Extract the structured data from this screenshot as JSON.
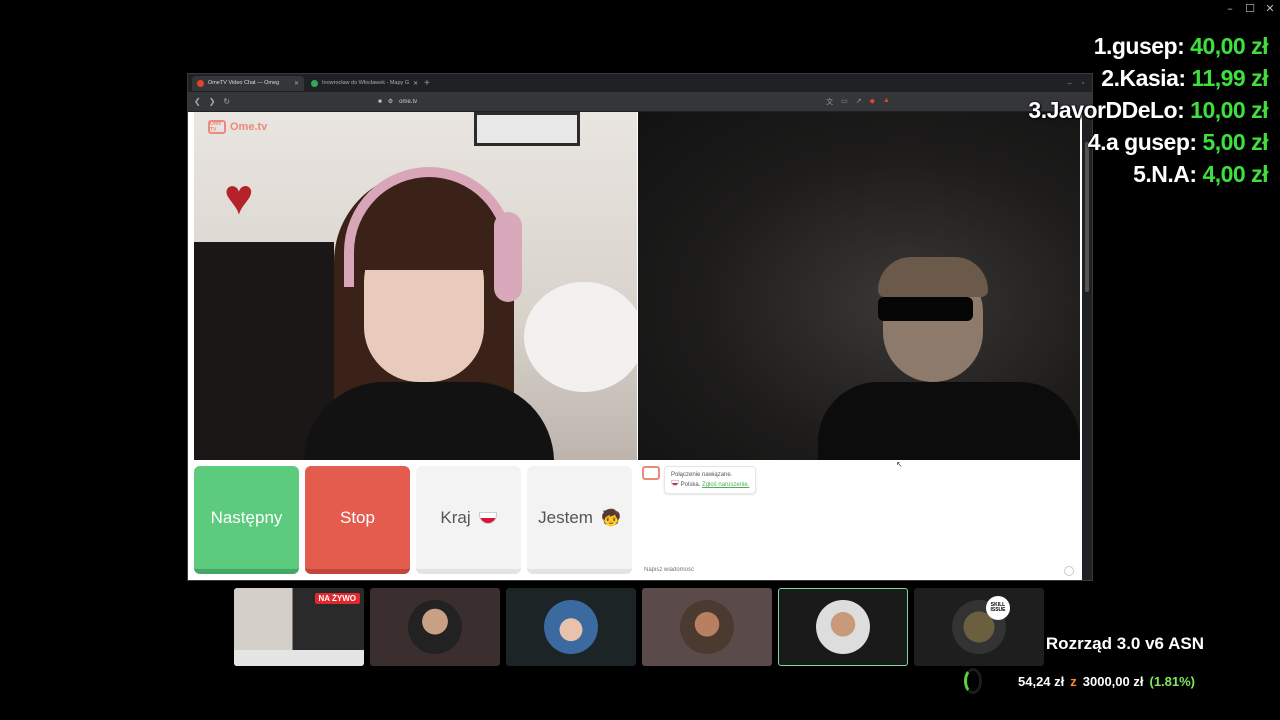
{
  "window_controls": {
    "minimize": "–",
    "maximize": "☐",
    "close": "✕"
  },
  "browser": {
    "tabs": [
      {
        "label": "OmeTV Video Chat — Omeg",
        "active": true
      },
      {
        "label": "Inowrocław do Włocławek - Mapy G",
        "active": false
      }
    ],
    "url": "ome.tv"
  },
  "ometv": {
    "logo": "Ome.tv",
    "logo_badge": "Ome TV",
    "buttons": {
      "next": "Następny",
      "stop": "Stop",
      "country": "Kraj",
      "gender": "Jestem"
    },
    "chat": {
      "line1": "Połączenie nawiązane.",
      "country": "Polska.",
      "report_link": "Zgłoś naruszenie.",
      "input_placeholder": "Napisz wiadomość"
    }
  },
  "leaderboard": [
    {
      "rank": "1.",
      "name": "gusep:",
      "amount": "40,00 zł"
    },
    {
      "rank": "2.",
      "name": "Kasia:",
      "amount": "11,99 zł"
    },
    {
      "rank": "3.",
      "name": "JavorDDeLo:",
      "amount": "10,00 zł"
    },
    {
      "rank": "4.",
      "name": "a gusep:",
      "amount": "5,00 zł"
    },
    {
      "rank": "5.",
      "name": "N.A:",
      "amount": "4,00 zł"
    }
  ],
  "stream_bar": {
    "live_badge": "NA ŻYWO",
    "skill_badge": "SKILL ISSUE"
  },
  "goal": {
    "title": "Rozrząd 3.0 v6 ASN",
    "current": "54,24 zł",
    "separator": "z",
    "target": "3000,00 zł",
    "percent": "(1.81%)",
    "progress_fraction": 0.0181
  },
  "colors": {
    "next_button": "#5ccb7e",
    "stop_button": "#e35c4e",
    "leaderboard_amount": "#3ee03e",
    "goal_percent": "#7fe860",
    "live_badge": "#e0282e"
  }
}
